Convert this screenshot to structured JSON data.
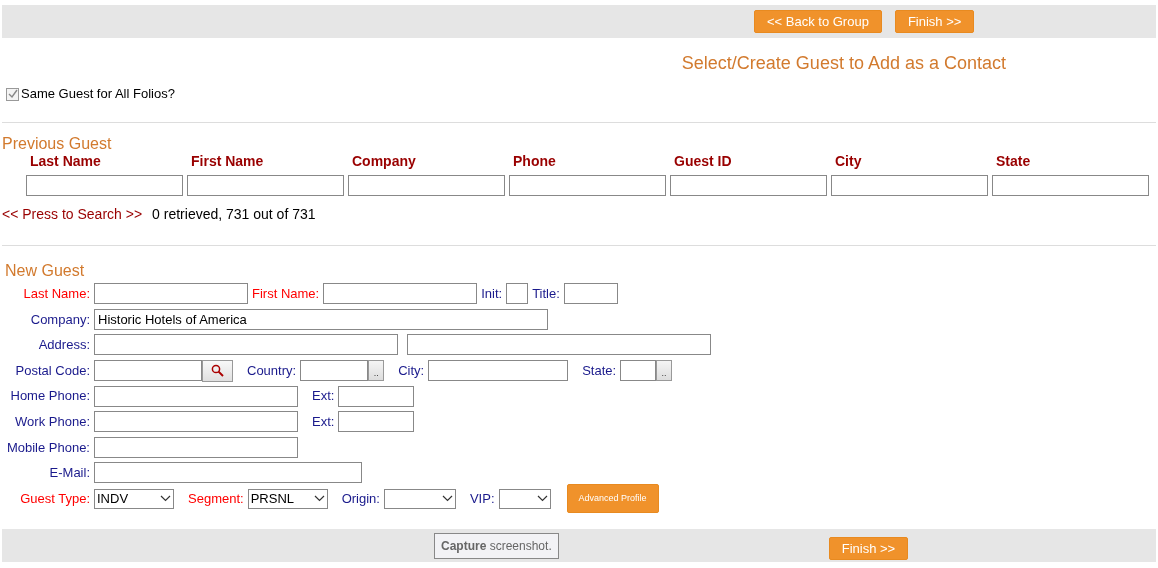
{
  "top_bar": {
    "buttons": [
      "<< Back to Group",
      "Finish >>"
    ]
  },
  "title": "Select/Create Guest to Add as a Contact",
  "same_guest": {
    "label": "Same Guest for All Folios?",
    "checked": true
  },
  "previous_guest": {
    "heading": "Previous Guest",
    "columns": [
      "Last Name",
      "First Name",
      "Company",
      "Phone",
      "Guest ID",
      "City",
      "State"
    ],
    "search_link": "<< Press to Search >>",
    "result": "0 retrieved, 731 out of 731"
  },
  "new_guest": {
    "heading": "New Guest",
    "rows": [
      {
        "items": [
          {
            "kind": "label",
            "text": "Last Name:",
            "required": true
          },
          {
            "kind": "input"
          },
          {
            "kind": "label",
            "text": "First Name:",
            "required": true
          },
          {
            "kind": "input"
          },
          {
            "kind": "label",
            "text": "Init:",
            "required": false
          },
          {
            "kind": "input"
          },
          {
            "kind": "label",
            "text": "Title:",
            "required": false
          },
          {
            "kind": "input"
          }
        ]
      },
      {
        "items": [
          {
            "kind": "label",
            "text": "Company:",
            "required": false
          },
          {
            "kind": "input",
            "value": "Historic Hotels of America"
          }
        ]
      },
      {
        "items": [
          {
            "kind": "label",
            "text": "Address:",
            "required": false
          },
          {
            "kind": "input"
          },
          {
            "kind": "input"
          }
        ]
      },
      {
        "items": [
          {
            "kind": "label",
            "text": "Postal Code:",
            "required": false
          },
          {
            "kind": "input"
          },
          {
            "kind": "search"
          },
          {
            "kind": "label",
            "text": "Country:",
            "required": false
          },
          {
            "kind": "input"
          },
          {
            "kind": "lookup",
            "text": ".."
          },
          {
            "kind": "label",
            "text": "City:",
            "required": false
          },
          {
            "kind": "input"
          },
          {
            "kind": "label",
            "text": "State:",
            "required": false
          },
          {
            "kind": "input"
          },
          {
            "kind": "lookup",
            "text": ".."
          }
        ]
      },
      {
        "items": [
          {
            "kind": "label",
            "text": "Home Phone:",
            "required": false
          },
          {
            "kind": "input"
          },
          {
            "kind": "label",
            "text": "Ext:",
            "required": false
          },
          {
            "kind": "input"
          }
        ]
      },
      {
        "items": [
          {
            "kind": "label",
            "text": "Work Phone:",
            "required": false
          },
          {
            "kind": "input"
          },
          {
            "kind": "label",
            "text": "Ext:",
            "required": false
          },
          {
            "kind": "input"
          }
        ]
      },
      {
        "items": [
          {
            "kind": "label",
            "text": "Mobile Phone:",
            "required": false
          },
          {
            "kind": "input"
          }
        ]
      },
      {
        "items": [
          {
            "kind": "label",
            "text": "E-Mail:",
            "required": false
          },
          {
            "kind": "input"
          }
        ]
      },
      {
        "items": [
          {
            "kind": "label",
            "text": "Guest Type:",
            "required": true
          },
          {
            "kind": "select",
            "value": "INDV"
          },
          {
            "kind": "label",
            "text": "Segment:",
            "required": true
          },
          {
            "kind": "select",
            "value": "PRSNL"
          },
          {
            "kind": "label",
            "text": "Origin:",
            "required": false
          },
          {
            "kind": "select"
          },
          {
            "kind": "label",
            "text": "VIP:",
            "required": false
          },
          {
            "kind": "select"
          },
          {
            "kind": "button",
            "text": "Advanced Profile"
          }
        ]
      }
    ]
  },
  "bottom_bar": {
    "capture": "**Capture** screenshot.",
    "button": "Finish >>"
  }
}
